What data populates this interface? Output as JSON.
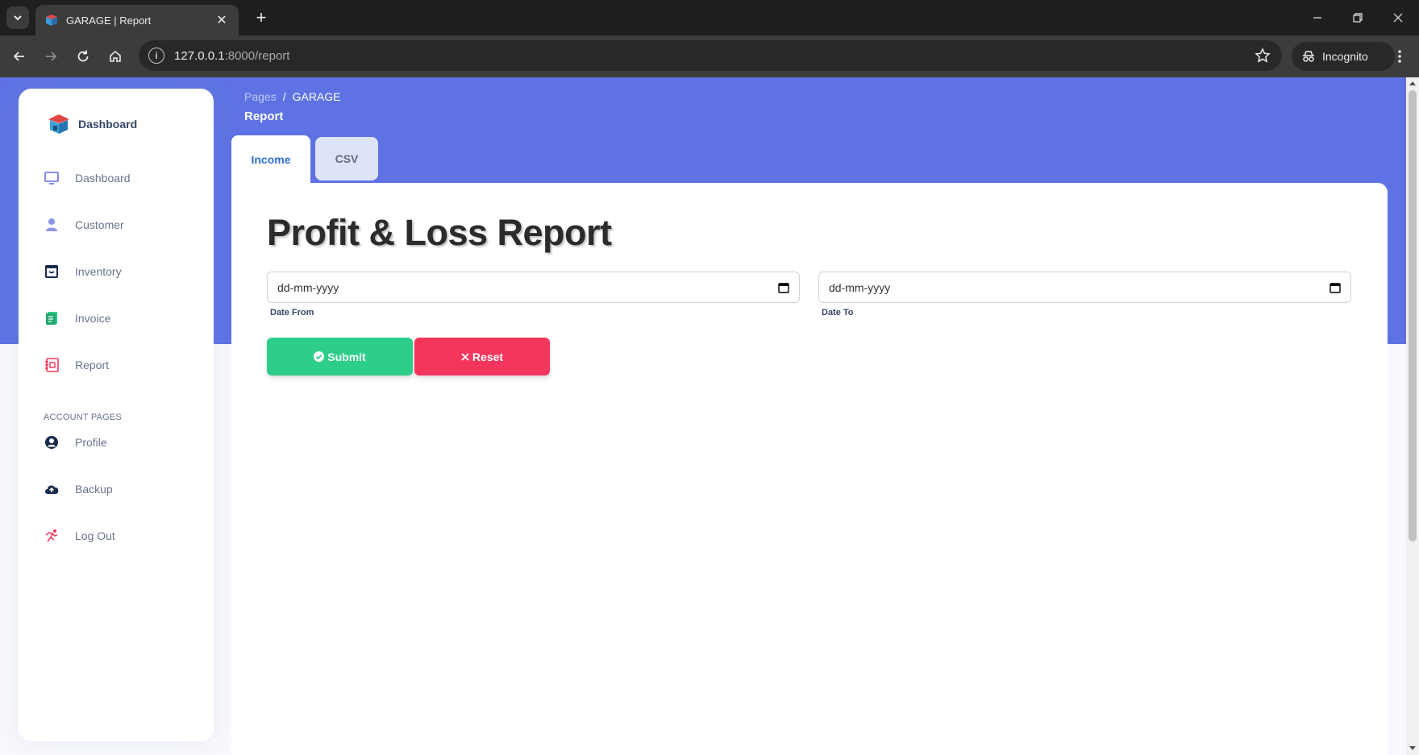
{
  "browser": {
    "tab_title": "GARAGE | Report",
    "new_tab_label": "+",
    "url_host": "127.0.0.1",
    "url_rest": ":8000/report",
    "incognito_label": "Incognito"
  },
  "sidebar": {
    "brand": "Dashboard",
    "items": [
      {
        "label": "Dashboard",
        "icon": "monitor-icon",
        "color": "#5e72e4"
      },
      {
        "label": "Customer",
        "icon": "user-icon",
        "color": "#8b95e8"
      },
      {
        "label": "Inventory",
        "icon": "archive-icon",
        "color": "#172b4d"
      },
      {
        "label": "Invoice",
        "icon": "document-icon",
        "color": "#2dce89"
      },
      {
        "label": "Report",
        "icon": "report-icon",
        "color": "#f5365c"
      }
    ],
    "account_heading": "ACCOUNT PAGES",
    "account_items": [
      {
        "label": "Profile",
        "icon": "user-circle-icon",
        "color": "#172b4d"
      },
      {
        "label": "Backup",
        "icon": "cloud-upload-icon",
        "color": "#172b4d"
      },
      {
        "label": "Log Out",
        "icon": "running-icon",
        "color": "#f5365c"
      }
    ]
  },
  "header": {
    "breadcrumb_root": "Pages",
    "breadcrumb_sep": "/",
    "breadcrumb_current": "GARAGE",
    "title": "Report"
  },
  "tabs": {
    "income": "Income",
    "csv": "CSV"
  },
  "report": {
    "title": "Profit & Loss Report",
    "date_from": {
      "value": "dd-mm-yyyy",
      "label": "Date From"
    },
    "date_to": {
      "value": "dd-mm-yyyy",
      "label": "Date To"
    },
    "submit_label": "Submit",
    "reset_label": "Reset"
  },
  "colors": {
    "primary": "#5e72e4",
    "success": "#2dce89",
    "danger": "#f5365c"
  }
}
